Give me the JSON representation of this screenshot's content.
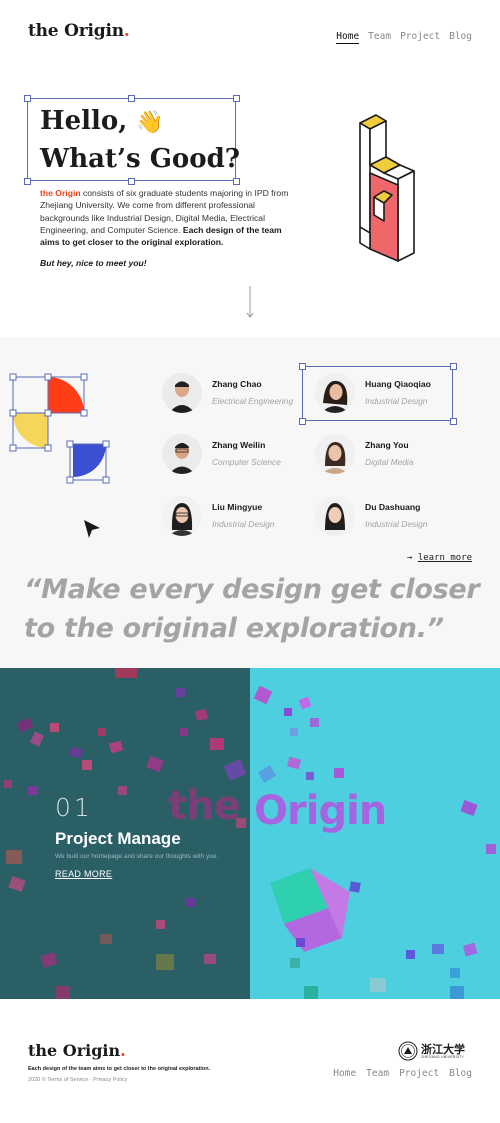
{
  "header": {
    "logo": "the Origin",
    "logo_dot": ".",
    "nav": [
      "Home",
      "Team",
      "Project",
      "Blog"
    ]
  },
  "hero": {
    "title_line1": "Hello,",
    "wave_emoji": "👋",
    "title_line2": "What’s Good?",
    "body_brand": "the Origin",
    "body_text": " consists of six graduate students majoring in IPD from Zhejiang University. We come from different professional backgrounds like Industrial Design, Digital Media, Electrical Engineering, and Computer Science. ",
    "body_bold": "Each design of the team aims to get closer to the original exploration.",
    "tagline": "But hey, nice to meet you!"
  },
  "team": {
    "members": [
      {
        "name": "Zhang Chao",
        "role": "Electrical Engineering"
      },
      {
        "name": "Huang Qiaoqiao",
        "role": "Industrial Design"
      },
      {
        "name": "Zhang Weilin",
        "role": "Computer Science"
      },
      {
        "name": "Zhang You",
        "role": "Digital Media"
      },
      {
        "name": "Liu Mingyue",
        "role": "Industrial Design"
      },
      {
        "name": "Du Dashuang",
        "role": "Industrial Design"
      }
    ],
    "learn_more_arrow": "→",
    "learn_more": "learn more"
  },
  "quote": "“Make every design get closer to the original exploration.”",
  "project": {
    "number": "01",
    "title": "Project Manage",
    "description": "We built our homepage and share our thoughts with you.",
    "read_more": "READ MORE",
    "word_left": "the",
    "word_right": "Origin"
  },
  "footer": {
    "logo": "the Origin",
    "logo_dot": ".",
    "tagline": "Each design of the team aims to get closer to the original exploration.",
    "copyright": "2020 © Terms of Service · Privacy Policy",
    "nav": [
      "Home",
      "Team",
      "Project",
      "Blog"
    ],
    "university_cn": "浙江大学",
    "university_en": "ZHEJIANG UNIVERSITY"
  },
  "colors": {
    "accent": "#e8451e",
    "selection": "#5a6bb8",
    "project_left_bg": "#2a5f66",
    "project_right_bg": "#4ecfe0"
  }
}
